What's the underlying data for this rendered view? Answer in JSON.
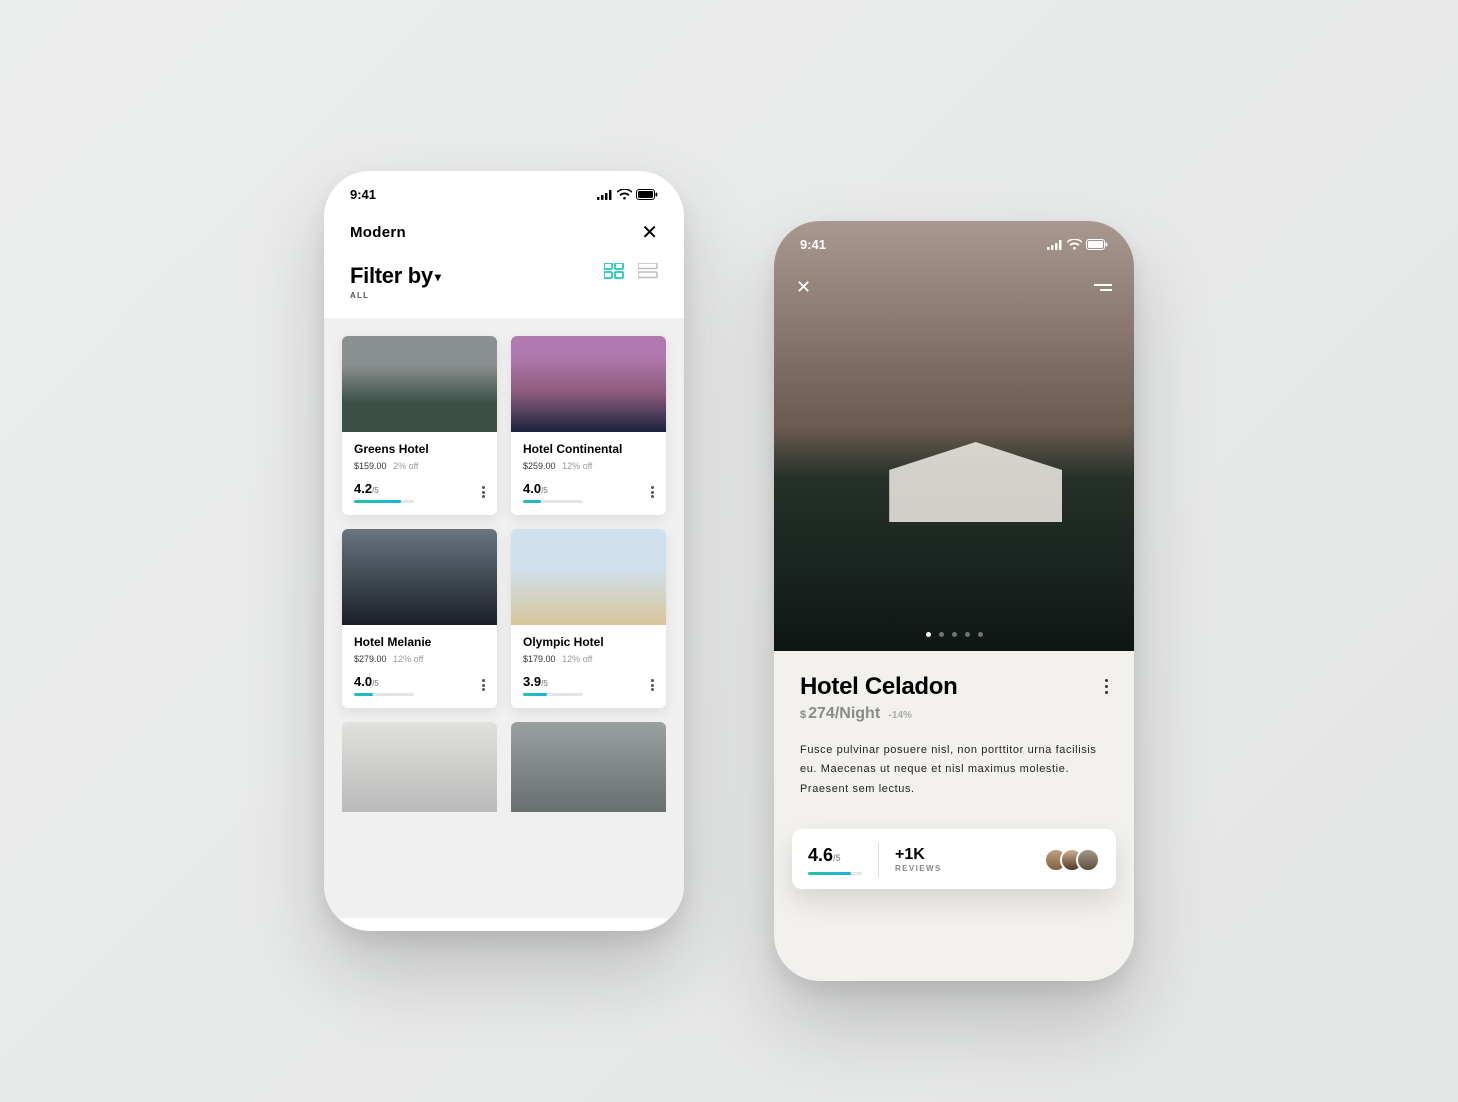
{
  "statusTime": "9:41",
  "screenA": {
    "pageTitle": "Modern",
    "filterTitle": "Filter by",
    "filterSubtitle": "ALL",
    "cards": [
      {
        "title": "Greens Hotel",
        "price": "$159.00",
        "discount": "2% off",
        "rating": "4.2",
        "outOf": "/5",
        "barPct": 78
      },
      {
        "title": "Hotel Continental",
        "price": "$259.00",
        "discount": "12% off",
        "rating": "4.0",
        "outOf": "/5",
        "barPct": 30
      },
      {
        "title": "Hotel Melanie",
        "price": "$279.00",
        "discount": "12% off",
        "rating": "4.0",
        "outOf": "/5",
        "barPct": 32
      },
      {
        "title": "Olympic Hotel",
        "price": "$179.00",
        "discount": "12% off",
        "rating": "3.9",
        "outOf": "/5",
        "barPct": 40
      }
    ]
  },
  "screenB": {
    "title": "Hotel Celadon",
    "currency": "$",
    "price": "274/Night",
    "discount": "-14%",
    "description": "Fusce pulvinar posuere nisl, non porttitor urna facilisis eu. Maecenas ut neque et nisl maximus molestie. Praesent sem lectus.",
    "rating": "4.6",
    "ratingOutOf": "/5",
    "reviewCount": "+1K",
    "reviewLabel": "REVIEWS"
  }
}
